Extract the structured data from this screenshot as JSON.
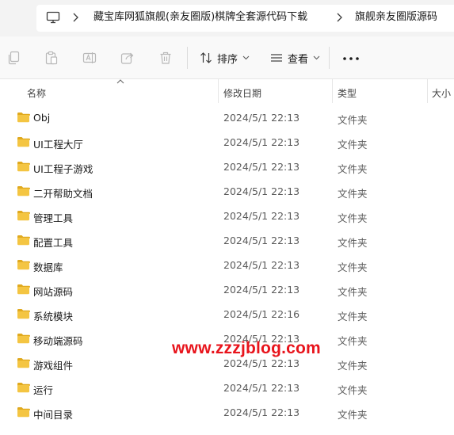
{
  "address_bar": {
    "icon": "this-pc-icon",
    "breadcrumbs": [
      "藏宝库网狐旗舰(亲友圈版)棋牌全套源代码下载",
      "旗舰亲友圈版源码"
    ]
  },
  "toolbar": {
    "icons": [
      "copy-icon",
      "paste-icon",
      "rename-icon",
      "share-icon",
      "delete-icon"
    ],
    "sort_label": "排序",
    "view_label": "查看",
    "more_icon": "more-icon"
  },
  "columns": {
    "name": "名称",
    "date": "修改日期",
    "type": "类型",
    "size": "大小"
  },
  "files": [
    {
      "name": "Obj",
      "date": "2024/5/1 22:13",
      "type": "文件夹"
    },
    {
      "name": "UI工程大厅",
      "date": "2024/5/1 22:13",
      "type": "文件夹"
    },
    {
      "name": "UI工程子游戏",
      "date": "2024/5/1 22:13",
      "type": "文件夹"
    },
    {
      "name": "二开帮助文档",
      "date": "2024/5/1 22:13",
      "type": "文件夹"
    },
    {
      "name": "管理工具",
      "date": "2024/5/1 22:13",
      "type": "文件夹"
    },
    {
      "name": "配置工具",
      "date": "2024/5/1 22:13",
      "type": "文件夹"
    },
    {
      "name": "数据库",
      "date": "2024/5/1 22:13",
      "type": "文件夹"
    },
    {
      "name": "网站源码",
      "date": "2024/5/1 22:13",
      "type": "文件夹"
    },
    {
      "name": "系统模块",
      "date": "2024/5/1 22:16",
      "type": "文件夹"
    },
    {
      "name": "移动端源码",
      "date": "2024/5/1 22:13",
      "type": "文件夹"
    },
    {
      "name": "游戏组件",
      "date": "2024/5/1 22:13",
      "type": "文件夹"
    },
    {
      "name": "运行",
      "date": "2024/5/1 22:13",
      "type": "文件夹"
    },
    {
      "name": "中间目录",
      "date": "2024/5/1 22:13",
      "type": "文件夹"
    }
  ],
  "watermark": "www.zzzjblog.com",
  "colors": {
    "folder": "#f4c542",
    "watermark": "#e8141c",
    "disabled_icon": "#b8b8b8"
  }
}
